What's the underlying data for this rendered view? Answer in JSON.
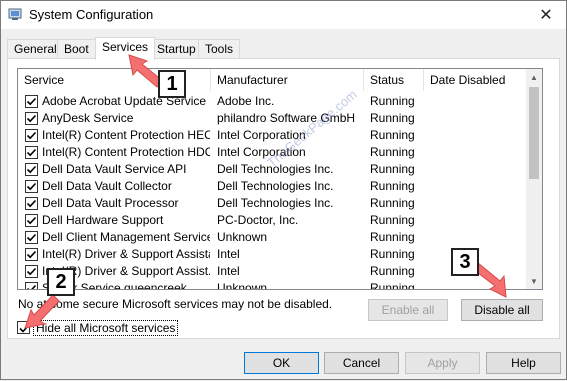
{
  "window": {
    "title": "System Configuration",
    "close_glyph": "✕"
  },
  "tabs": [
    {
      "label": "General"
    },
    {
      "label": "Boot"
    },
    {
      "label": "Services"
    },
    {
      "label": "Startup"
    },
    {
      "label": "Tools"
    }
  ],
  "columns": [
    "Service",
    "Manufacturer",
    "Status",
    "Date Disabled"
  ],
  "rows": [
    {
      "service": "Adobe Acrobat Update Service",
      "manufacturer": "Adobe Inc.",
      "status": "Running",
      "checked": true
    },
    {
      "service": "AnyDesk Service",
      "manufacturer": "philandro Software GmbH",
      "status": "Running",
      "checked": true
    },
    {
      "service": "Intel(R) Content Protection HEC...",
      "manufacturer": "Intel Corporation",
      "status": "Running",
      "checked": true
    },
    {
      "service": "Intel(R) Content Protection HDC...",
      "manufacturer": "Intel Corporation",
      "status": "Running",
      "checked": true
    },
    {
      "service": "Dell Data Vault Service API",
      "manufacturer": "Dell Technologies Inc.",
      "status": "Running",
      "checked": true
    },
    {
      "service": "Dell Data Vault Collector",
      "manufacturer": "Dell Technologies Inc.",
      "status": "Running",
      "checked": true
    },
    {
      "service": "Dell Data Vault Processor",
      "manufacturer": "Dell Technologies Inc.",
      "status": "Running",
      "checked": true
    },
    {
      "service": "Dell Hardware Support",
      "manufacturer": "PC-Doctor, Inc.",
      "status": "Running",
      "checked": true
    },
    {
      "service": "Dell Client Management Service",
      "manufacturer": "Unknown",
      "status": "Running",
      "checked": true
    },
    {
      "service": "Intel(R) Driver & Support Assistant",
      "manufacturer": "Intel",
      "status": "Running",
      "checked": true
    },
    {
      "service": "Intel(R) Driver & Support Assist...",
      "manufacturer": "Intel",
      "status": "Running",
      "checked": true
    },
    {
      "service": "Server Service queencreek",
      "manufacturer": "Unknown",
      "status": "Running",
      "checked": true
    }
  ],
  "note": "No    at some secure Microsoft services may not be disabled.",
  "buttons": {
    "enable_all": "Enable all",
    "disable_all": "Disable all",
    "ok": "OK",
    "cancel": "Cancel",
    "apply": "Apply",
    "help": "Help"
  },
  "hide_ms": {
    "label": "Hide all Microsoft services",
    "checked": true
  },
  "annotations": {
    "step1": "1",
    "step2": "2",
    "step3": "3"
  },
  "colors": {
    "arrow": "#f47070",
    "focus": "#0078d7"
  },
  "watermark": "TheGeekPage.com"
}
